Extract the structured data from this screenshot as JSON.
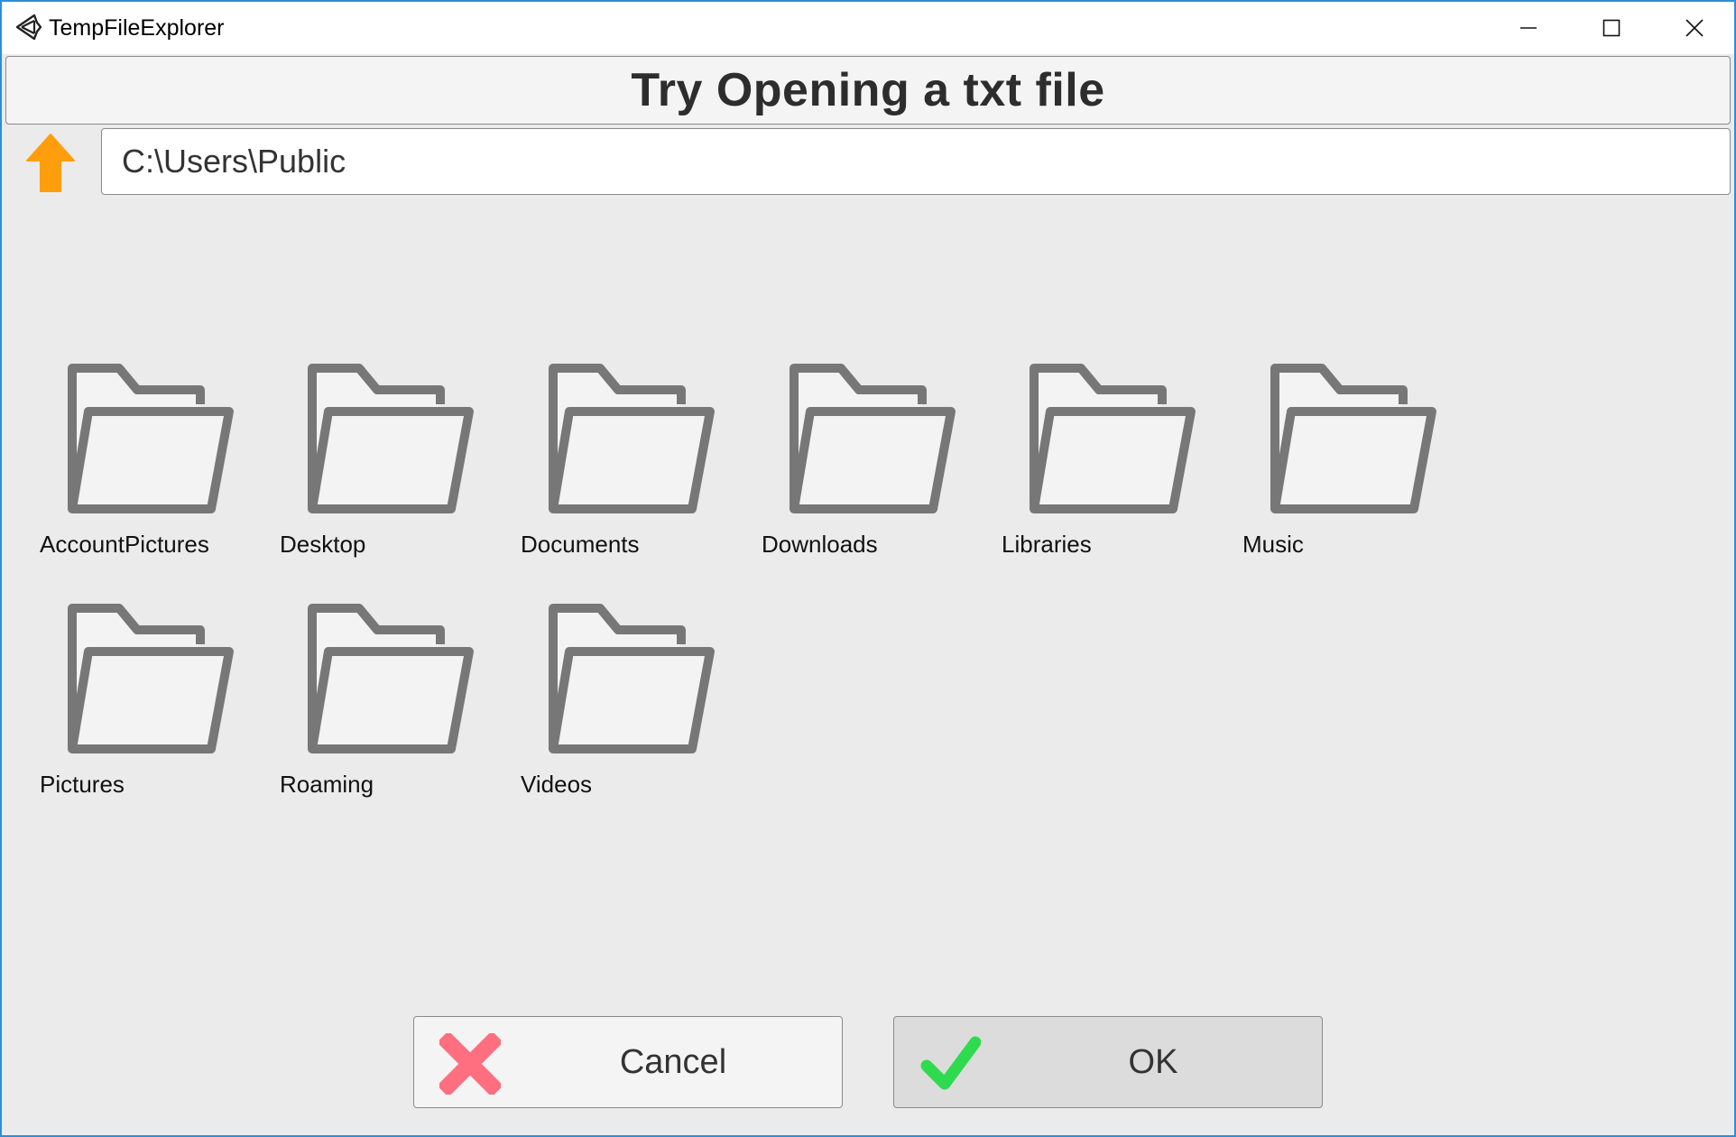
{
  "window": {
    "title": "TempFileExplorer"
  },
  "header": {
    "title": "Try Opening a txt file"
  },
  "path_bar": {
    "current_path": "C:\\Users\\Public"
  },
  "folders": [
    {
      "label": "AccountPictures",
      "icon": "folder-icon"
    },
    {
      "label": "Desktop",
      "icon": "folder-icon"
    },
    {
      "label": "Documents",
      "icon": "folder-icon"
    },
    {
      "label": "Downloads",
      "icon": "folder-icon"
    },
    {
      "label": "Libraries",
      "icon": "folder-icon"
    },
    {
      "label": "Music",
      "icon": "folder-icon"
    },
    {
      "label": "Pictures",
      "icon": "folder-icon"
    },
    {
      "label": "Roaming",
      "icon": "folder-icon"
    },
    {
      "label": "Videos",
      "icon": "folder-icon"
    }
  ],
  "buttons": {
    "cancel_label": "Cancel",
    "ok_label": "OK"
  },
  "colors": {
    "window_border": "#2b8fd8",
    "up_arrow": "#ff9e0d",
    "cancel_x": "#ff6f7f",
    "ok_check": "#2edb4f",
    "folder_stroke": "#777777",
    "folder_fill": "#f3f3f3"
  }
}
